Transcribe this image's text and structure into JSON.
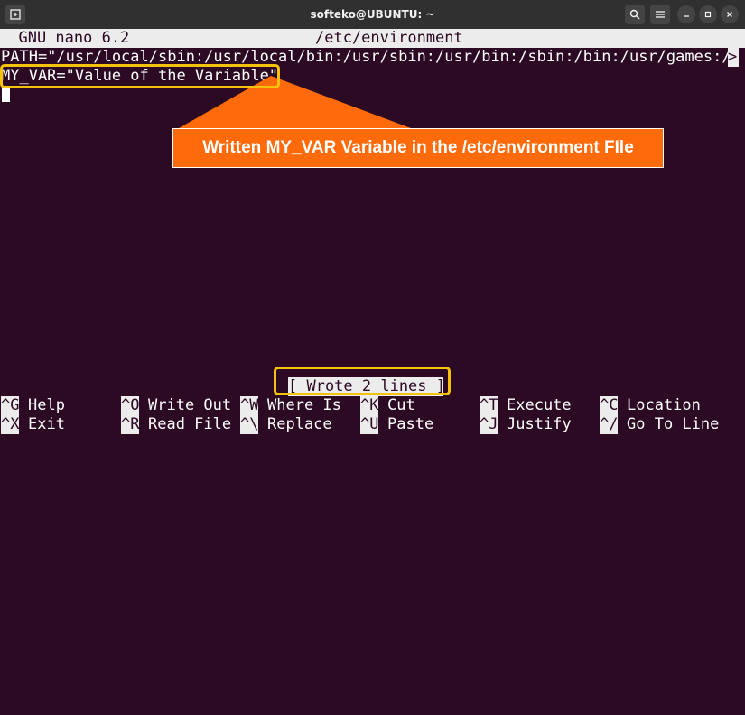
{
  "window": {
    "title": "softeko@UBUNTU: ~",
    "colors": {
      "terminal_bg": "#2c0a23",
      "titlebar_bg": "#303030",
      "highlight": "#f4c20d",
      "callout": "#ff6a0a"
    }
  },
  "nano": {
    "header_version": "  GNU nano 6.2",
    "header_file": "/etc/environment",
    "lines": [
      "PATH=\"/usr/local/sbin:/usr/local/bin:/usr/sbin:/usr/bin:/sbin:/bin:/usr/games:/",
      "MY_VAR=\"Value of the Variable\""
    ],
    "overflow_marker": ">",
    "status": "[ Wrote 2 lines ]",
    "shortcuts_row1": [
      {
        "key": "^G",
        "label": "Help"
      },
      {
        "key": "^O",
        "label": "Write Out"
      },
      {
        "key": "^W",
        "label": "Where Is"
      },
      {
        "key": "^K",
        "label": "Cut"
      },
      {
        "key": "^T",
        "label": "Execute"
      },
      {
        "key": "^C",
        "label": "Location"
      }
    ],
    "shortcuts_row2": [
      {
        "key": "^X",
        "label": "Exit"
      },
      {
        "key": "^R",
        "label": "Read File"
      },
      {
        "key": "^\\",
        "label": "Replace"
      },
      {
        "key": "^U",
        "label": "Paste"
      },
      {
        "key": "^J",
        "label": "Justify"
      },
      {
        "key": "^/",
        "label": "Go To Line"
      }
    ]
  },
  "annotation": {
    "text": "Written MY_VAR Variable in the /etc/environment FIle"
  }
}
